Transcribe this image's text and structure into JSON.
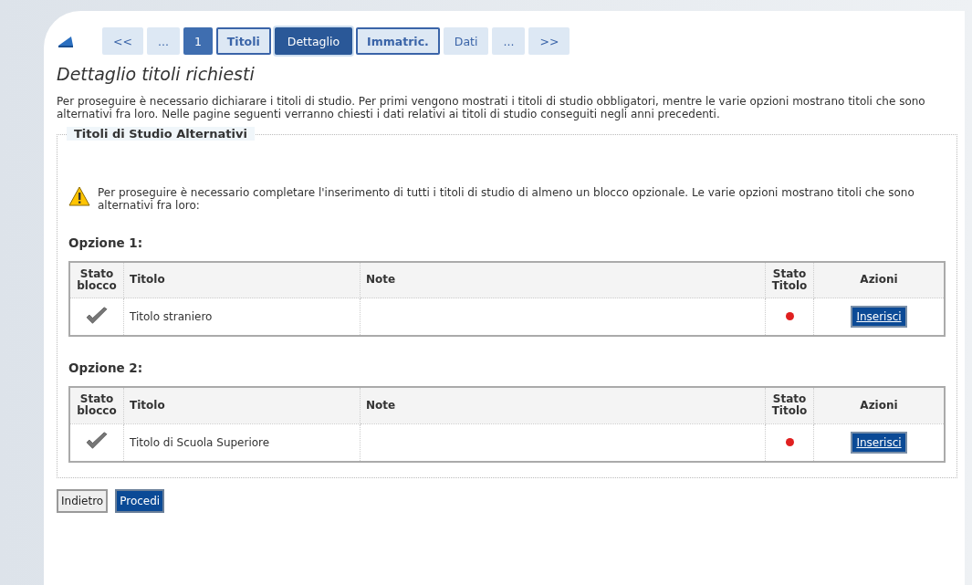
{
  "steps": [
    {
      "label": "<<",
      "kind": "nav",
      "selected": false
    },
    {
      "label": "...",
      "kind": "nav",
      "selected": false
    },
    {
      "label": "1",
      "kind": "past",
      "selected": false
    },
    {
      "label": "Titoli",
      "kind": "linked",
      "selected": false
    },
    {
      "label": "Dettaglio",
      "kind": "past",
      "selected": true
    },
    {
      "label": "Immatric.",
      "kind": "linked",
      "selected": false
    },
    {
      "label": "Dati",
      "kind": "nav",
      "selected": false
    },
    {
      "label": "...",
      "kind": "nav",
      "selected": false
    },
    {
      "label": ">>",
      "kind": "nav",
      "selected": false
    }
  ],
  "title": "Dettaglio titoli richiesti",
  "intro": "Per proseguire è necessario dichiarare i titoli di studio. Per primi vengono mostrati i titoli di studio obbligatori, mentre le varie opzioni mostrano titoli che sono alternativi fra loro. Nelle pagine seguenti verranno chiesti i dati relativi ai titoli di studio conseguiti negli anni precedenti.",
  "section": {
    "legend": "Titoli di Studio Alternativi",
    "warning": "Per proseguire è necessario completare l'inserimento di tutti i titoli di studio di almeno un blocco opzionale. Le varie opzioni mostrano titoli che sono alternativi fra loro:",
    "options": [
      {
        "heading": "Opzione 1:",
        "columns": [
          "Stato blocco",
          "Titolo",
          "Note",
          "Stato Titolo",
          "Azioni"
        ],
        "rows": [
          {
            "titolo": "Titolo straniero",
            "block_ok": true,
            "color": "#e02020",
            "action": "Inserisci"
          }
        ]
      },
      {
        "heading": "Opzione 2:",
        "columns": [
          "Stato blocco",
          "Titolo",
          "Note",
          "Stato Titolo",
          "Azioni"
        ],
        "rows": [
          {
            "titolo": "Titolo di Scuola Superiore",
            "block_ok": true,
            "color": "#e02020",
            "action": "Inserisci"
          }
        ]
      }
    ]
  },
  "buttons": [
    {
      "label": "Indietro",
      "kind": "secondary"
    },
    {
      "label": "Procedi",
      "kind": "primary"
    }
  ]
}
